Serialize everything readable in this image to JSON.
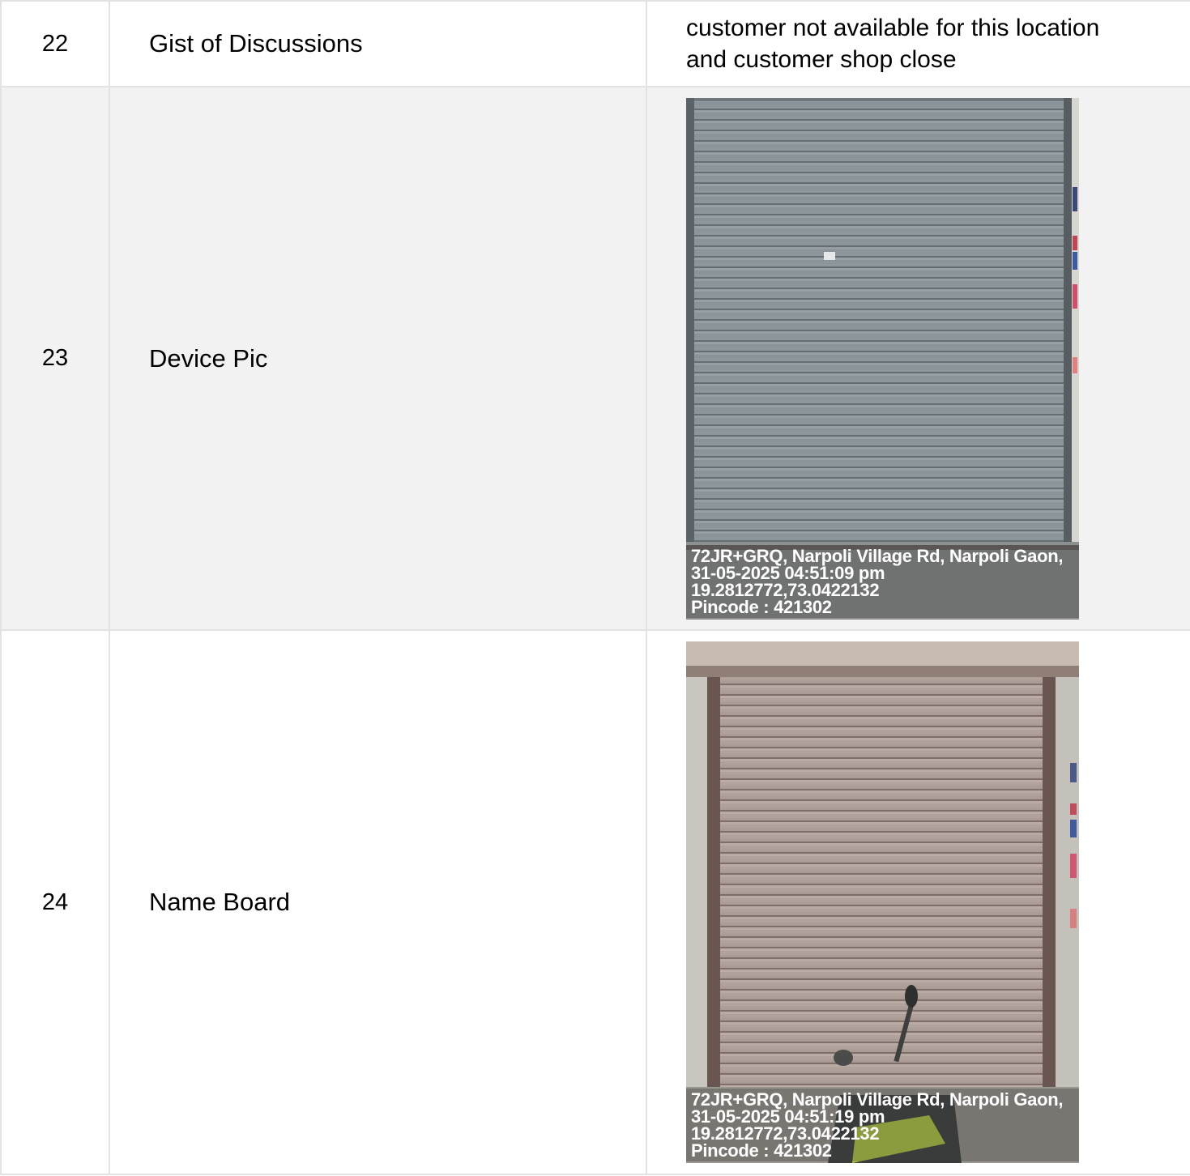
{
  "rows": [
    {
      "num": "22",
      "label": "Gist of Discussions",
      "value_lines": [
        "customer not available for this location",
        "and customer shop close"
      ]
    },
    {
      "num": "23",
      "label": "Device Pic",
      "photo": {
        "lines": [
          "72JR+GRQ, Narpoli Village Rd, Narpoli Gaon,",
          "31-05-2025 04:51:09 pm",
          "19.2812772,73.0422132",
          "Pincode : 421302"
        ]
      }
    },
    {
      "num": "24",
      "label": "Name Board",
      "photo": {
        "lines": [
          "72JR+GRQ, Narpoli Village Rd, Narpoli Gaon,",
          "31-05-2025 04:51:19 pm",
          "19.2812772,73.0422132",
          "Pincode : 421302"
        ]
      }
    }
  ]
}
